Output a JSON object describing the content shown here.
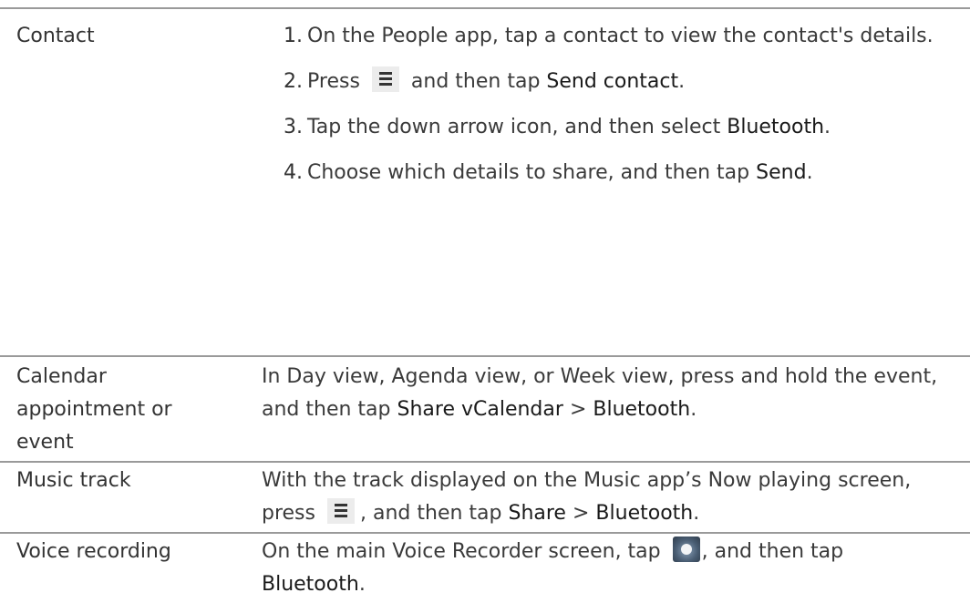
{
  "rows": {
    "contact": {
      "label": "Contact",
      "steps": [
        {
          "num": "1.",
          "text_a": "On the People app, tap a contact to view the contact's details."
        },
        {
          "num": "2.",
          "text_a": "Press",
          "icon": "menu-icon",
          "text_b": "and then tap",
          "bold": "Send contact",
          "text_c": "."
        },
        {
          "num": "3.",
          "text_a": "Tap the down arrow icon, and then select",
          "bold": "Bluetooth",
          "text_c": "."
        },
        {
          "num": "4.",
          "text_a": "Choose which details to share, and then tap",
          "bold": "Send",
          "text_c": "."
        }
      ]
    },
    "calendar": {
      "label": "Calendar appointment or event",
      "text_a": "In Day view, Agenda view, or Week view, press and hold the event, and then tap",
      "bold_a": "Share vCalendar",
      "sep": ">",
      "bold_b": "Bluetooth",
      "text_c": "."
    },
    "music": {
      "label": "Music track",
      "text_a": "With the track displayed on the Music app’s Now playing screen, press",
      "icon": "menu-icon",
      "text_b": ", and then tap",
      "bold_a": "Share",
      "sep": ">",
      "bold_b": "Bluetooth",
      "text_c": "."
    },
    "voice": {
      "label": "Voice recording",
      "text_a": "On the main Voice Recorder screen, tap",
      "icon": "voice-recorder-share-icon",
      "text_b": ", and then tap",
      "bold_a": "Bluetooth",
      "text_c": "."
    }
  }
}
